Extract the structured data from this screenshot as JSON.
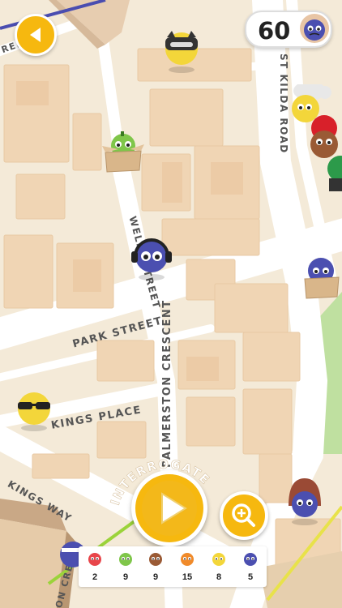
{
  "streets": {
    "st_kilda": "ST KILDA ROAD",
    "wells": "WELLS STREET",
    "park": "PARK STREET",
    "palmerston": "PALMERSTON CRESCENT",
    "kings_place": "KINGS PLACE",
    "kings_way": "KINGS WAY",
    "top_left": "REE",
    "bottom_left": "ON CRE"
  },
  "hud": {
    "score": "60",
    "interrogate_label": "INTERROGATE"
  },
  "suspect_counts": [
    {
      "color": "#e8454a",
      "count": "2"
    },
    {
      "color": "#7fc64a",
      "count": "9"
    },
    {
      "color": "#9a5a35",
      "count": "9"
    },
    {
      "color": "#f08a2a",
      "count": "15"
    },
    {
      "color": "#f3d63a",
      "count": "8"
    },
    {
      "color": "#4b4fb0",
      "count": "5"
    }
  ]
}
